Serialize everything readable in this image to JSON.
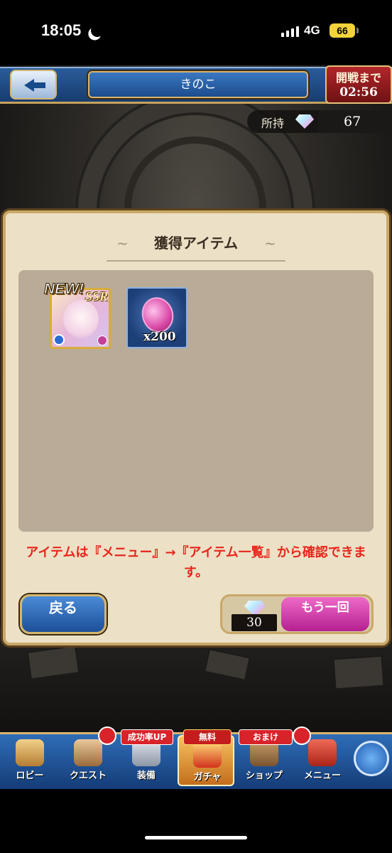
{
  "status_bar": {
    "time": "18:05",
    "network": "4G",
    "battery": "66"
  },
  "header": {
    "title": "きのこ",
    "timer_label": "開戦まで",
    "timer_value": "02:56"
  },
  "owned": {
    "label": "所持",
    "count": "67",
    "icon": "gem-icon"
  },
  "panel": {
    "title": "獲得アイテム",
    "items": [
      {
        "kind": "character",
        "new_label": "NEW!",
        "rarity": "SSR"
      },
      {
        "kind": "coin",
        "quantity": "x200"
      }
    ],
    "notice": "アイテムは『メニュー』→『アイテム一覧』から確認できます。"
  },
  "buttons": {
    "return_label": "戻る",
    "again_label": "もう一回",
    "again_cost": "30"
  },
  "bottom_nav": {
    "items": [
      {
        "label": "ロビー"
      },
      {
        "label": "クエスト"
      },
      {
        "label": "装備"
      },
      {
        "label": "ガチャ"
      },
      {
        "label": "ショップ"
      },
      {
        "label": "メニュー"
      }
    ],
    "tags": {
      "equip": "成功率UP",
      "gacha": "無料",
      "shop": "おまけ"
    }
  },
  "colors": {
    "accent_gold": "#c9a867",
    "notice_red": "#e8261c",
    "again_pink": "#d93aaa",
    "nav_blue": "#2f6db6"
  }
}
